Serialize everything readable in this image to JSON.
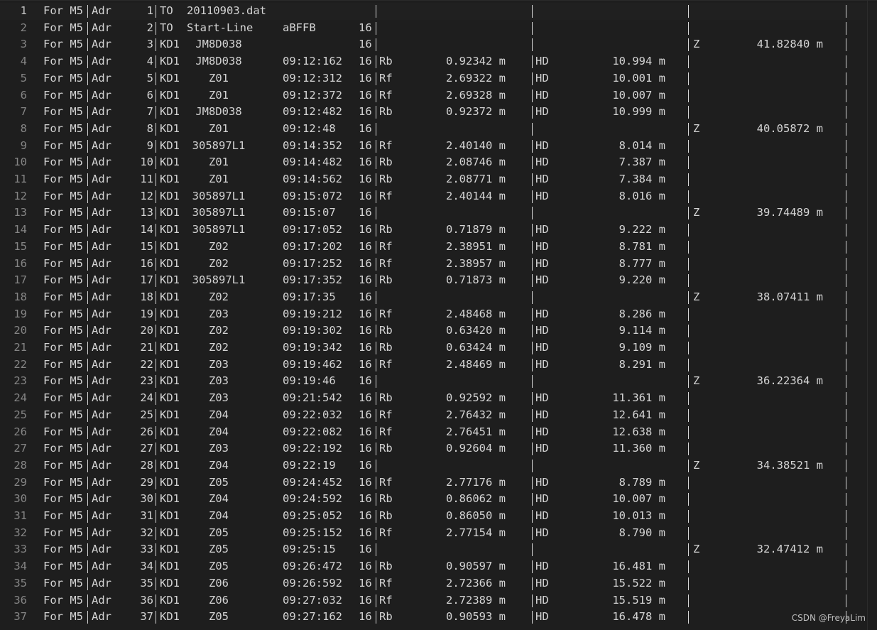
{
  "editor": {
    "theme_background": "#1e1e1e",
    "text_color": "#d4d4d4",
    "gutter_color": "#858585",
    "lines": [
      {
        "num": "1",
        "text": [
          "For M5",
          "Adr",
          "1",
          "TO",
          "20110903.dat",
          "",
          "",
          "",
          "",
          "",
          "",
          "",
          ""
        ]
      },
      {
        "num": "2",
        "text": [
          "For M5",
          "Adr",
          "2",
          "TO",
          "Start-Line",
          "aBFFB",
          "16",
          "",
          "",
          "",
          "",
          "",
          ""
        ]
      },
      {
        "num": "3",
        "text": [
          "For M5",
          "Adr",
          "3",
          "KD1",
          "JM8D038",
          "",
          "16",
          "",
          "",
          "",
          "",
          "Z",
          "41.82840 m"
        ]
      },
      {
        "num": "4",
        "text": [
          "For M5",
          "Adr",
          "4",
          "KD1",
          "JM8D038",
          "09:12:162",
          "16",
          "Rb",
          "0.92342 m",
          "HD",
          "10.994 m",
          "",
          ""
        ]
      },
      {
        "num": "5",
        "text": [
          "For M5",
          "Adr",
          "5",
          "KD1",
          "Z01",
          "09:12:312",
          "16",
          "Rf",
          "2.69322 m",
          "HD",
          "10.001 m",
          "",
          ""
        ]
      },
      {
        "num": "6",
        "text": [
          "For M5",
          "Adr",
          "6",
          "KD1",
          "Z01",
          "09:12:372",
          "16",
          "Rf",
          "2.69328 m",
          "HD",
          "10.007 m",
          "",
          ""
        ]
      },
      {
        "num": "7",
        "text": [
          "For M5",
          "Adr",
          "7",
          "KD1",
          "JM8D038",
          "09:12:482",
          "16",
          "Rb",
          "0.92372 m",
          "HD",
          "10.999 m",
          "",
          ""
        ]
      },
      {
        "num": "8",
        "text": [
          "For M5",
          "Adr",
          "8",
          "KD1",
          "Z01",
          "09:12:48",
          "16",
          "",
          "",
          "",
          "",
          "Z",
          "40.05872 m"
        ]
      },
      {
        "num": "9",
        "text": [
          "For M5",
          "Adr",
          "9",
          "KD1",
          "305897L1",
          "09:14:352",
          "16",
          "Rf",
          "2.40140 m",
          "HD",
          "8.014 m",
          "",
          ""
        ]
      },
      {
        "num": "10",
        "text": [
          "For M5",
          "Adr",
          "10",
          "KD1",
          "Z01",
          "09:14:482",
          "16",
          "Rb",
          "2.08746 m",
          "HD",
          "7.387 m",
          "",
          ""
        ]
      },
      {
        "num": "11",
        "text": [
          "For M5",
          "Adr",
          "11",
          "KD1",
          "Z01",
          "09:14:562",
          "16",
          "Rb",
          "2.08771 m",
          "HD",
          "7.384 m",
          "",
          ""
        ]
      },
      {
        "num": "12",
        "text": [
          "For M5",
          "Adr",
          "12",
          "KD1",
          "305897L1",
          "09:15:072",
          "16",
          "Rf",
          "2.40144 m",
          "HD",
          "8.016 m",
          "",
          ""
        ]
      },
      {
        "num": "13",
        "text": [
          "For M5",
          "Adr",
          "13",
          "KD1",
          "305897L1",
          "09:15:07",
          "16",
          "",
          "",
          "",
          "",
          "Z",
          "39.74489 m"
        ]
      },
      {
        "num": "14",
        "text": [
          "For M5",
          "Adr",
          "14",
          "KD1",
          "305897L1",
          "09:17:052",
          "16",
          "Rb",
          "0.71879 m",
          "HD",
          "9.222 m",
          "",
          ""
        ]
      },
      {
        "num": "15",
        "text": [
          "For M5",
          "Adr",
          "15",
          "KD1",
          "Z02",
          "09:17:202",
          "16",
          "Rf",
          "2.38951 m",
          "HD",
          "8.781 m",
          "",
          ""
        ]
      },
      {
        "num": "16",
        "text": [
          "For M5",
          "Adr",
          "16",
          "KD1",
          "Z02",
          "09:17:252",
          "16",
          "Rf",
          "2.38957 m",
          "HD",
          "8.777 m",
          "",
          ""
        ]
      },
      {
        "num": "17",
        "text": [
          "For M5",
          "Adr",
          "17",
          "KD1",
          "305897L1",
          "09:17:352",
          "16",
          "Rb",
          "0.71873 m",
          "HD",
          "9.220 m",
          "",
          ""
        ]
      },
      {
        "num": "18",
        "text": [
          "For M5",
          "Adr",
          "18",
          "KD1",
          "Z02",
          "09:17:35",
          "16",
          "",
          "",
          "",
          "",
          "Z",
          "38.07411 m"
        ]
      },
      {
        "num": "19",
        "text": [
          "For M5",
          "Adr",
          "19",
          "KD1",
          "Z03",
          "09:19:212",
          "16",
          "Rf",
          "2.48468 m",
          "HD",
          "8.286 m",
          "",
          ""
        ]
      },
      {
        "num": "20",
        "text": [
          "For M5",
          "Adr",
          "20",
          "KD1",
          "Z02",
          "09:19:302",
          "16",
          "Rb",
          "0.63420 m",
          "HD",
          "9.114 m",
          "",
          ""
        ]
      },
      {
        "num": "21",
        "text": [
          "For M5",
          "Adr",
          "21",
          "KD1",
          "Z02",
          "09:19:342",
          "16",
          "Rb",
          "0.63424 m",
          "HD",
          "9.109 m",
          "",
          ""
        ]
      },
      {
        "num": "22",
        "text": [
          "For M5",
          "Adr",
          "22",
          "KD1",
          "Z03",
          "09:19:462",
          "16",
          "Rf",
          "2.48469 m",
          "HD",
          "8.291 m",
          "",
          ""
        ]
      },
      {
        "num": "23",
        "text": [
          "For M5",
          "Adr",
          "23",
          "KD1",
          "Z03",
          "09:19:46",
          "16",
          "",
          "",
          "",
          "",
          "Z",
          "36.22364 m"
        ]
      },
      {
        "num": "24",
        "text": [
          "For M5",
          "Adr",
          "24",
          "KD1",
          "Z03",
          "09:21:542",
          "16",
          "Rb",
          "0.92592 m",
          "HD",
          "11.361 m",
          "",
          ""
        ]
      },
      {
        "num": "25",
        "text": [
          "For M5",
          "Adr",
          "25",
          "KD1",
          "Z04",
          "09:22:032",
          "16",
          "Rf",
          "2.76432 m",
          "HD",
          "12.641 m",
          "",
          ""
        ]
      },
      {
        "num": "26",
        "text": [
          "For M5",
          "Adr",
          "26",
          "KD1",
          "Z04",
          "09:22:082",
          "16",
          "Rf",
          "2.76451 m",
          "HD",
          "12.638 m",
          "",
          ""
        ]
      },
      {
        "num": "27",
        "text": [
          "For M5",
          "Adr",
          "27",
          "KD1",
          "Z03",
          "09:22:192",
          "16",
          "Rb",
          "0.92604 m",
          "HD",
          "11.360 m",
          "",
          ""
        ]
      },
      {
        "num": "28",
        "text": [
          "For M5",
          "Adr",
          "28",
          "KD1",
          "Z04",
          "09:22:19",
          "16",
          "",
          "",
          "",
          "",
          "Z",
          "34.38521 m"
        ]
      },
      {
        "num": "29",
        "text": [
          "For M5",
          "Adr",
          "29",
          "KD1",
          "Z05",
          "09:24:452",
          "16",
          "Rf",
          "2.77176 m",
          "HD",
          "8.789 m",
          "",
          ""
        ]
      },
      {
        "num": "30",
        "text": [
          "For M5",
          "Adr",
          "30",
          "KD1",
          "Z04",
          "09:24:592",
          "16",
          "Rb",
          "0.86062 m",
          "HD",
          "10.007 m",
          "",
          ""
        ]
      },
      {
        "num": "31",
        "text": [
          "For M5",
          "Adr",
          "31",
          "KD1",
          "Z04",
          "09:25:052",
          "16",
          "Rb",
          "0.86050 m",
          "HD",
          "10.013 m",
          "",
          ""
        ]
      },
      {
        "num": "32",
        "text": [
          "For M5",
          "Adr",
          "32",
          "KD1",
          "Z05",
          "09:25:152",
          "16",
          "Rf",
          "2.77154 m",
          "HD",
          "8.790 m",
          "",
          ""
        ]
      },
      {
        "num": "33",
        "text": [
          "For M5",
          "Adr",
          "33",
          "KD1",
          "Z05",
          "09:25:15",
          "16",
          "",
          "",
          "",
          "",
          "Z",
          "32.47412 m"
        ]
      },
      {
        "num": "34",
        "text": [
          "For M5",
          "Adr",
          "34",
          "KD1",
          "Z05",
          "09:26:472",
          "16",
          "Rb",
          "0.90597 m",
          "HD",
          "16.481 m",
          "",
          ""
        ]
      },
      {
        "num": "35",
        "text": [
          "For M5",
          "Adr",
          "35",
          "KD1",
          "Z06",
          "09:26:592",
          "16",
          "Rf",
          "2.72366 m",
          "HD",
          "15.522 m",
          "",
          ""
        ]
      },
      {
        "num": "36",
        "text": [
          "For M5",
          "Adr",
          "36",
          "KD1",
          "Z06",
          "09:27:032",
          "16",
          "Rf",
          "2.72389 m",
          "HD",
          "15.519 m",
          "",
          ""
        ]
      },
      {
        "num": "37",
        "text": [
          "For M5",
          "Adr",
          "37",
          "KD1",
          "Z05",
          "09:27:162",
          "16",
          "Rb",
          "0.90593 m",
          "HD",
          "16.478 m",
          "",
          ""
        ]
      }
    ]
  },
  "watermark": "CSDN @FreyaLim"
}
